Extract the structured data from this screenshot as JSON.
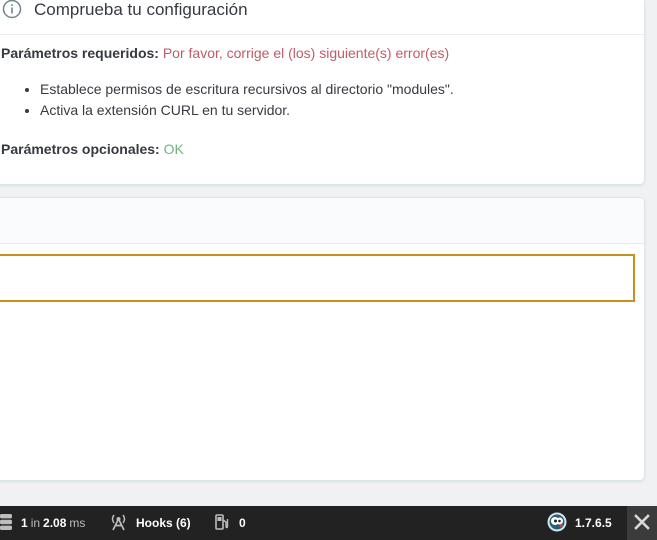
{
  "config_panel": {
    "title": "Comprueba tu configuración",
    "required_label": "Parámetros requeridos:",
    "required_status": "Por favor, corrige el (los) siguiente(s) error(es)",
    "errors": [
      "Establece permisos de escritura recursivos al directorio \"modules\".",
      "Activa la extensión CURL en tu servidor."
    ],
    "optional_label": "Parámetros opcionales:",
    "optional_status": "OK",
    "info_icon": "info-circle-icon"
  },
  "second_panel": {
    "input_value": ""
  },
  "debugbar": {
    "queries_count": "1",
    "queries_in": "in",
    "queries_time": "2.08",
    "queries_unit": "ms",
    "hooks_label": "Hooks (6)",
    "memory_value": "0",
    "version": "1.7.6.5",
    "icons": {
      "database": "database-icon",
      "hooks": "hooks-antenna-icon",
      "memory": "fuel-icon",
      "logo": "prestashop-logo-icon",
      "close": "close-icon"
    }
  },
  "colors": {
    "error": "#c05c67",
    "ok": "#70b580",
    "focus_border": "#c7921c",
    "debugbar_bg": "#222222"
  }
}
